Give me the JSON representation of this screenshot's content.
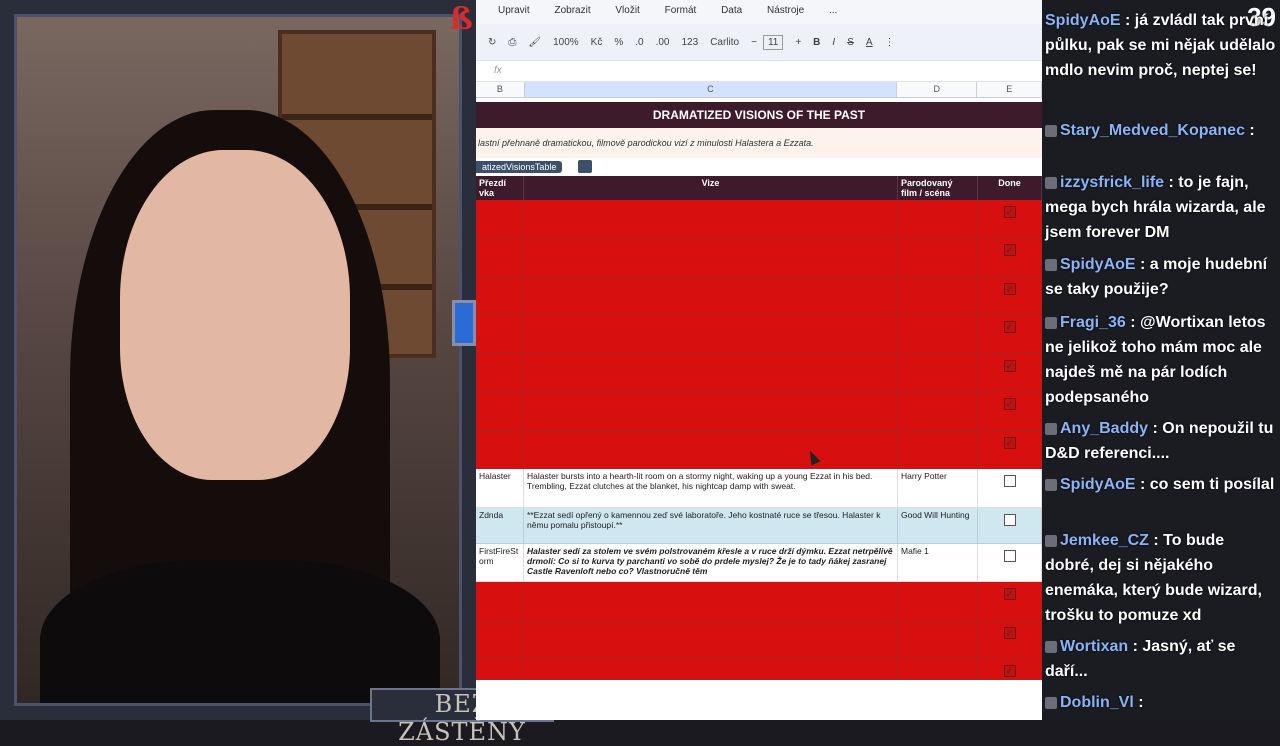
{
  "menu": [
    "Upravit",
    "Zobrazit",
    "Vložit",
    "Formát",
    "Data",
    "Nástroje",
    "..."
  ],
  "toolbar": {
    "zoom": "100%",
    "currency": "Kč",
    "percent": "%",
    "dec1": ".0",
    "dec2": ".00",
    "num": "123",
    "font": "Carlito",
    "font_size": "11"
  },
  "formula_label": "fx",
  "columns": [
    "B",
    "C",
    "D",
    "E"
  ],
  "sheet_title": "DRAMATIZED VISIONS OF THE PAST",
  "sheet_subtitle": "lastní přehnaně dramatickou, filmově parodickou vizí z minulosti Halastera a Ezzata.",
  "table_name": "atizedVisionsTable",
  "headers": {
    "col1": "Přezdí\nvka",
    "col2": "Vize",
    "col3": "Parodovaný\nfilm / scéna",
    "col4": "Done"
  },
  "rows": [
    {
      "style": "red",
      "c1": "",
      "c2": "",
      "c3": "",
      "done": true
    },
    {
      "style": "red",
      "c1": "",
      "c2": "",
      "c3": "",
      "done": true
    },
    {
      "style": "red",
      "c1": "",
      "c2": "",
      "c3": "",
      "done": true
    },
    {
      "style": "red",
      "c1": "",
      "c2": "",
      "c3": "",
      "done": true
    },
    {
      "style": "red",
      "c1": "",
      "c2": "",
      "c3": "",
      "done": true
    },
    {
      "style": "red",
      "c1": "",
      "c2": "",
      "c3": "",
      "done": true
    },
    {
      "style": "red",
      "c1": "",
      "c2": "",
      "c3": "",
      "done": true
    },
    {
      "style": "white",
      "c1": "Halaster",
      "c2": "Halaster bursts into a hearth-lit room on a stormy night, waking up a young Ezzat in his bed. Trembling, Ezzat clutches at the blanket, his nightcap damp with sweat.",
      "c3": "Harry Potter",
      "done": false
    },
    {
      "style": "blue",
      "c1": "Zdnda",
      "c2": "**Ezzat sedí opřený o kamennou zeď své laboratoře. Jeho kostnaté ruce se třesou. Halaster k němu pomalu přistoupí.**",
      "c3": "Good Will Hunting",
      "done": false
    },
    {
      "style": "white",
      "c1": "FirstFireSt orm",
      "c2": "Halaster sedí za stolem ve svém polstrovaném křesle a v ruce drží dýmku. Ezzat netrpělivě drmolí: Co si to kurva ty parchanti vo sobě do prdele myslej? Že je to tady ňákej zasranej Castle Ravenloft nebo co? Vlastnoručně těm",
      "c3": "Mafie 1",
      "done": false
    },
    {
      "style": "red",
      "c1": "",
      "c2": "",
      "c3": "",
      "done": true
    },
    {
      "style": "red",
      "c1": "",
      "c2": "",
      "c3": "",
      "done": true
    },
    {
      "style": "red",
      "c1": "",
      "c2": "",
      "c3": "",
      "done": true
    }
  ],
  "brand": "BEZ ZÁSTĚNY",
  "viewer_count": "39",
  "chat": [
    {
      "user": "SpidyAoE",
      "text": ": já zvládl tak první půlku, pak se mi nějak udělalo mdlo nevim proč, neptej se!"
    },
    {
      "user": "Stary_Medved_Kopanec",
      "text": ":"
    },
    {
      "user": "izzysfrick_life",
      "text": ": to je fajn, mega bych hrála wizarda, ale jsem forever DM"
    },
    {
      "user": "SpidyAoE",
      "text": ": a moje hudební se taky použije?"
    },
    {
      "user": "Fragi_36",
      "text": ": @Wortixan letos ne jelikož toho mám moc ale najdeš mě na pár lodích podepsaného"
    },
    {
      "user": "Any_Baddy",
      "text": ": On nepoužil tu D&D referenci...."
    },
    {
      "user": "SpidyAoE",
      "text": ": co sem ti posílal"
    },
    {
      "user": "Jemkee_CZ",
      "text": ": To bude dobré, dej si nějakého enemáka, který bude wizard, trošku to pomuze xd"
    },
    {
      "user": "Wortixan",
      "text": ": Jasný, ať se daří..."
    },
    {
      "user": "Doblin_Vl",
      "text": ":"
    }
  ]
}
